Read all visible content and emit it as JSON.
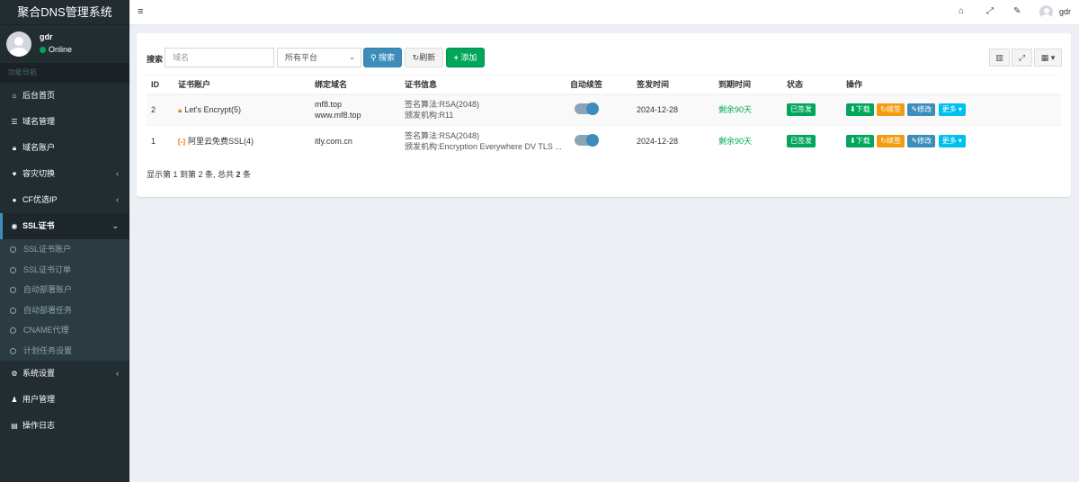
{
  "app": {
    "title": "聚合DNS管理系统"
  },
  "user": {
    "name": "gdr",
    "status": "Online"
  },
  "sidebar": {
    "header": "功能导航",
    "items": [
      {
        "icon": "home-icon",
        "glyph": "⌂",
        "label": "后台首页"
      },
      {
        "icon": "list-icon",
        "glyph": "☰",
        "label": "域名管理"
      },
      {
        "icon": "lock-icon",
        "glyph": "🔒︎",
        "label": "域名账户"
      },
      {
        "icon": "heartbeat-icon",
        "glyph": "♥",
        "label": "容灾切换"
      },
      {
        "icon": "globe-icon",
        "glyph": "●",
        "label": "CF优选IP"
      },
      {
        "icon": "globe-icon",
        "glyph": "◉",
        "label": "SSL证书"
      }
    ],
    "sub_items": [
      "SSL证书账户",
      "SSL证书订单",
      "自动部署账户",
      "自动部署任务",
      "CNAME代理",
      "计划任务设置"
    ],
    "bottom_items": [
      {
        "icon": "cogs-icon",
        "glyph": "⚙",
        "label": "系统设置"
      },
      {
        "icon": "user-icon",
        "glyph": "♟",
        "label": "用户管理"
      },
      {
        "icon": "list-alt-icon",
        "glyph": "▤",
        "label": "操作日志"
      }
    ]
  },
  "topbar": {
    "user": "gdr"
  },
  "toolbar": {
    "search_label": "搜索",
    "domain_placeholder": "域名",
    "platform_selected": "所有平台",
    "search_btn": "搜索",
    "refresh_btn": "刷新",
    "add_btn": "添加"
  },
  "table": {
    "headers": [
      "ID",
      "证书账户",
      "绑定域名",
      "证书信息",
      "自动续签",
      "签发时间",
      "到期时间",
      "状态",
      "操作"
    ],
    "rows": [
      {
        "id": "2",
        "account": "Let's Encrypt(5)",
        "domain1": "mf8.top",
        "domain2": "www.mf8.top",
        "info1": "签名算法:RSA(2048)",
        "info2": "颁发机构:R11",
        "issued": "2024-12-28",
        "expire": "剩余90天",
        "status": "已签发"
      },
      {
        "id": "1",
        "account": "阿里云免费SSL(4)",
        "domain1": "itly.com.cn",
        "domain2": "",
        "info1": "签名算法:RSA(2048)",
        "info2": "颁发机构:Encryption Everywhere DV TLS ...",
        "issued": "2024-12-28",
        "expire": "剩余90天",
        "status": "已签发"
      }
    ],
    "actions": {
      "download": "下载",
      "renew": "续签",
      "edit": "修改",
      "more": "更多"
    }
  },
  "pagination": {
    "prefix": "显示第 1 到第 2 条, 总共 ",
    "total": "2",
    "suffix": " 条"
  },
  "colors": {
    "sidebar": "#222d32",
    "primary": "#3c8dbc",
    "success": "#00a65a",
    "warning": "#f39c12",
    "info": "#00c0ef"
  }
}
